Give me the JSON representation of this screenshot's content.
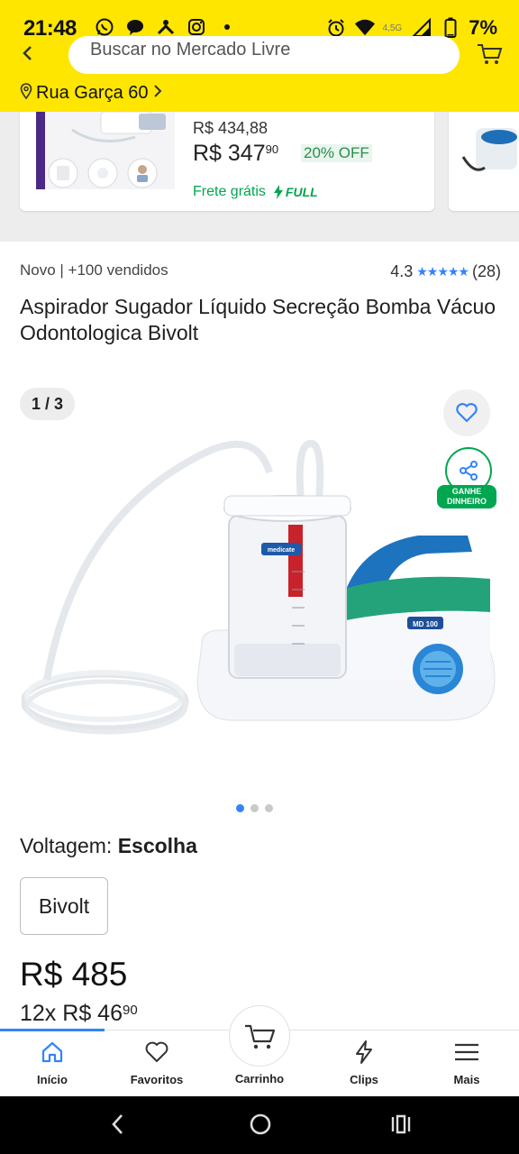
{
  "status_bar": {
    "time": "21:48",
    "network": "4,5G",
    "battery": "7%"
  },
  "header": {
    "search_placeholder": "Buscar no Mercado Livre",
    "address": "Rua Garça 60"
  },
  "recommendation": {
    "old_price": "R$ 434,88",
    "price_int": "R$ 347",
    "price_cents": "90",
    "discount": "20% OFF",
    "shipping": "Frete grátis",
    "full_label": "FULL"
  },
  "product": {
    "condition_sold": "Novo  |  +100 vendidos",
    "rating": "4.3",
    "reviews_count": "(28)",
    "title": "Aspirador Sugador Líquido Secreção Bomba Vácuo Odontologica Bivolt",
    "image_counter": "1 / 3",
    "share_label": "GANHE DINHEIRO",
    "image_brand": "medicate",
    "image_model": "MD 100",
    "carousel_dots": 3,
    "carousel_active": 0
  },
  "variation": {
    "label": "Voltagem: ",
    "value": "Escolha",
    "option": "Bivolt"
  },
  "pricing": {
    "price": "R$ 485",
    "installments_prefix": "12x",
    "installment_int": "R$ 46",
    "installment_cents": "90"
  },
  "bottom_nav": {
    "items": [
      {
        "label": "Início"
      },
      {
        "label": "Favoritos"
      },
      {
        "label": "Carrinho"
      },
      {
        "label": "Clips"
      },
      {
        "label": "Mais"
      }
    ]
  },
  "colors": {
    "brand_yellow": "#fee600",
    "accent_blue": "#3483fa",
    "green": "#00a650"
  }
}
